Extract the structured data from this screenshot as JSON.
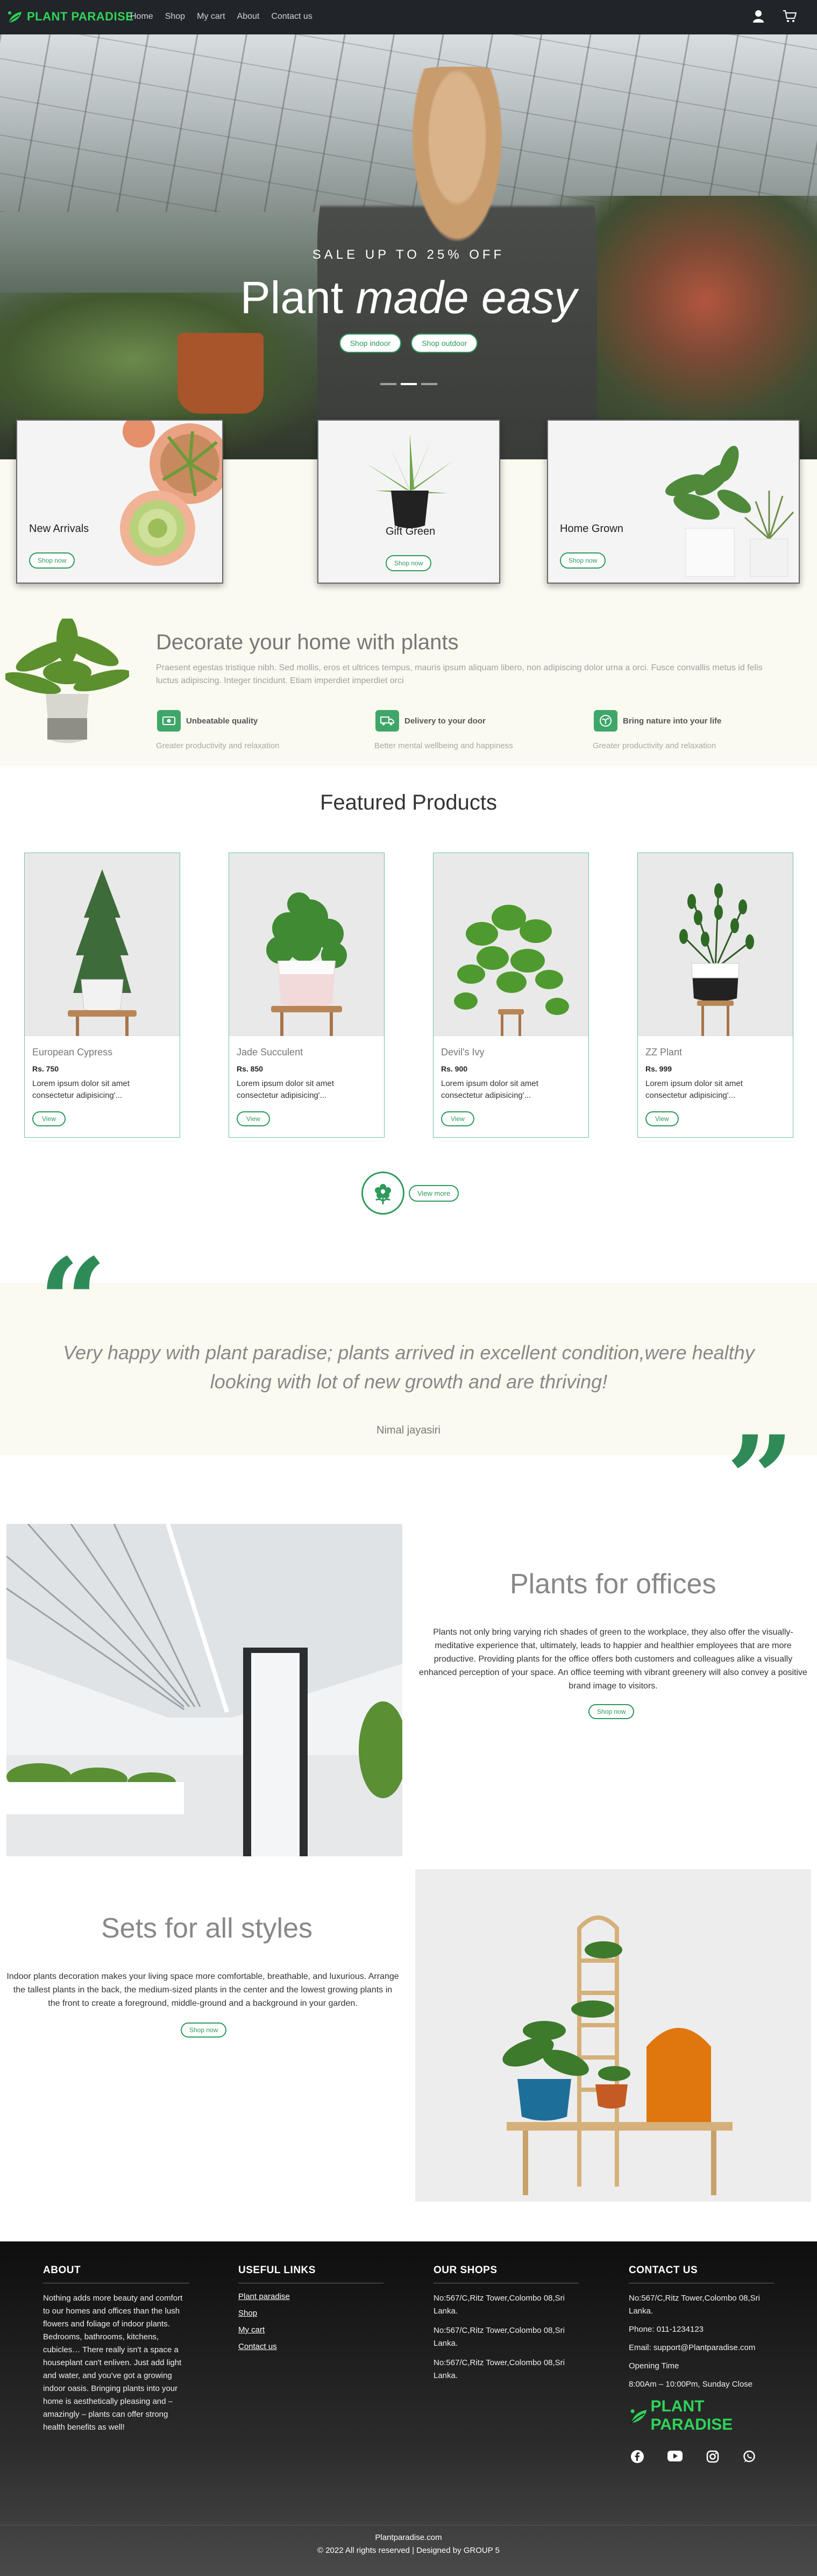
{
  "nav": {
    "brand": "PLANT PARADISE",
    "links": [
      "Home",
      "Shop",
      "My cart",
      "About",
      "Contact us"
    ],
    "icons": [
      "user-icon",
      "cart-icon"
    ]
  },
  "hero": {
    "sale": "SALE UP TO 25% OFF",
    "title_plain": "Plant ",
    "title_italic": "made easy",
    "btn_indoor": "Shop indoor",
    "btn_outdoor": "Shop outdoor"
  },
  "categories": [
    {
      "title": "New Arrivals",
      "button": "Shop now"
    },
    {
      "title": "Gift Green",
      "button": "Shop now"
    },
    {
      "title": "Home Grown",
      "button": "Shop now"
    }
  ],
  "decorate": {
    "title": "Decorate your home with plants",
    "text": "Praesent egestas tristique nibh. Sed mollis, eros et ultrices tempus, mauris ipsum aliquam libero, non adipiscing dolor urna a orci. Fusce convallis metus id felis luctus adipiscing. Integer tincidunt. Etiam imperdiet imperdiet orci",
    "features": [
      {
        "title": "Unbeatable quality",
        "sub": "Greater productivity and relaxation",
        "icon": "money-icon"
      },
      {
        "title": "Delivery to your door",
        "sub": "Better mental wellbeing and happiness",
        "icon": "truck-icon"
      },
      {
        "title": "Bring nature into your life",
        "sub": "Greater productivity and relaxation",
        "icon": "plant-icon"
      }
    ]
  },
  "featured": {
    "title": "Featured Products",
    "products": [
      {
        "name": "European Cypress",
        "price": "Rs. 750",
        "desc": "Lorem ipsum dolor sit amet consectetur adipisicing'...",
        "button": "View"
      },
      {
        "name": "Jade Succulent",
        "price": "Rs. 850",
        "desc": "Lorem ipsum dolor sit amet consectetur adipisicing'...",
        "button": "View"
      },
      {
        "name": "Devil's Ivy",
        "price": "Rs. 900",
        "desc": "Lorem ipsum dolor sit amet consectetur adipisicing'...",
        "button": "View"
      },
      {
        "name": "ZZ Plant",
        "price": "Rs. 999",
        "desc": "Lorem ipsum dolor sit amet consectetur adipisicing'...",
        "button": "View"
      }
    ],
    "view_more": "View more"
  },
  "testimonial": {
    "quote": "Very happy with plant paradise; plants arrived in excellent condition,were healthy looking with lot of new growth and are thriving!",
    "author": "Nimal jayasiri"
  },
  "offices": {
    "title": "Plants for offices",
    "text": "Plants not only bring varying rich shades of green to the workplace, they also offer the visually-meditative experience that, ultimately, leads to happier and healthier employees that are more productive. Providing plants for the office offers both customers and colleagues alike a visually enhanced perception of your space. An office teeming with vibrant greenery will also convey a positive brand image to visitors.",
    "button": "Shop now"
  },
  "sets": {
    "title": "Sets for all styles",
    "text": "Indoor plants decoration makes your living space more comfortable, breathable, and luxurious. Arrange the tallest plants in the back, the medium-sized plants in the center and the lowest growing plants in the front to create a foreground, middle-ground and a background in your garden.",
    "button": "Shop now"
  },
  "footer": {
    "about_title": "ABOUT",
    "about_text": "Nothing adds more beauty and comfort to our homes and offices than the lush flowers and foliage of indoor plants. Bedrooms, bathrooms, kitchens, cubicles… There really isn't a space a houseplant can't enliven. Just add light and water, and you've got a growing indoor oasis. Bringing plants into your home is aesthetically pleasing and – amazingly – plants can offer strong health benefits as well!",
    "links_title": "USEFUL LINKS",
    "links": [
      "Plant paradise",
      "Shop",
      "My cart",
      "Contact us"
    ],
    "shops_title": "OUR SHOPS",
    "shops": [
      "No:567/C,Ritz Tower,Colombo 08,Sri Lanka.",
      "No:567/C,Ritz Tower,Colombo 08,Sri Lanka.",
      "No:567/C,Ritz Tower,Colombo 08,Sri Lanka."
    ],
    "contact_title": "CONTACT US",
    "address": "No:567/C,Ritz Tower,Colombo 08,Sri Lanka.",
    "phone": "Phone: 011-1234123",
    "email": "Email: support@Plantparadise.com",
    "hours_label": "Opening Time",
    "hours": "8:00Am – 10:00Pm, Sunday Close",
    "brand": "PLANT PARADISE",
    "social": [
      "facebook-icon",
      "youtube-icon",
      "instagram-icon",
      "whatsapp-icon"
    ],
    "site": "Plantparadise.com",
    "copyright": "© 2022 All rights reserved | Designed by GROUP 5"
  },
  "colors": {
    "accent": "#2e9a5b",
    "brand": "#2fd35a",
    "beige": "#fbfaf0",
    "nav": "#212529"
  }
}
